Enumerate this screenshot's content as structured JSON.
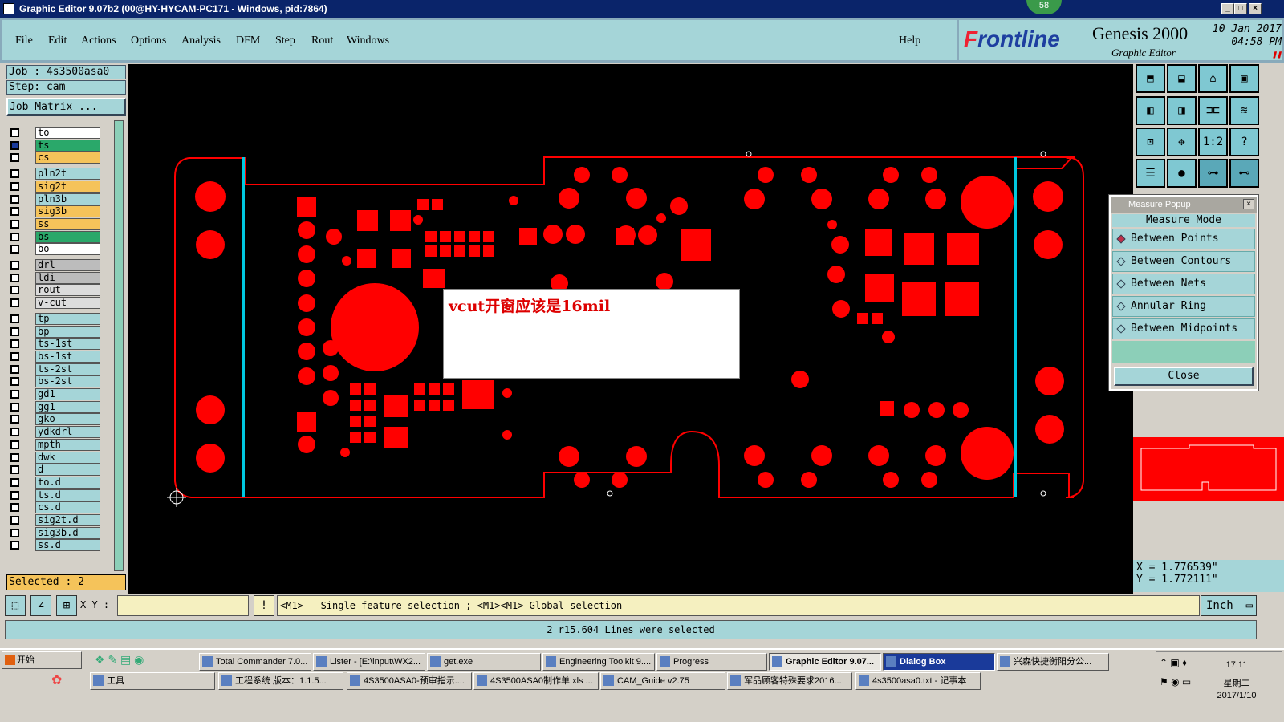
{
  "window": {
    "title": "Graphic Editor 9.07b2 (00@HY-HYCAM-PC171 - Windows, pid:7864)",
    "notification_count": "58"
  },
  "menu": {
    "file": "File",
    "edit": "Edit",
    "actions": "Actions",
    "options": "Options",
    "analysis": "Analysis",
    "dfm": "DFM",
    "step": "Step",
    "rout": "Rout",
    "windows": "Windows",
    "help": "Help"
  },
  "brand": {
    "logo_prefix": "F",
    "logo_rest": "rontline",
    "product": "Genesis 2000",
    "subtitle": "Graphic Editor",
    "date": "10 Jan 2017",
    "time": "04:58 PM"
  },
  "job": {
    "job_label": "Job :  4s3500asa0",
    "step_label": "Step:  cam",
    "matrix_button": "Job Matrix ..."
  },
  "layers": [
    {
      "name": "to",
      "color": "#ffffff"
    },
    {
      "name": "ts",
      "color": "#2aa86a"
    },
    {
      "name": "cs",
      "color": "#f5c35a"
    },
    {
      "name": "pln2t",
      "color": "#a5d5d8"
    },
    {
      "name": "sig2t",
      "color": "#f5c35a"
    },
    {
      "name": "pln3b",
      "color": "#a5d5d8"
    },
    {
      "name": "sig3b",
      "color": "#f5c35a"
    },
    {
      "name": "ss",
      "color": "#f5c35a"
    },
    {
      "name": "bs",
      "color": "#2aa86a"
    },
    {
      "name": "bo",
      "color": "#ffffff"
    },
    {
      "name": "drl",
      "color": "#bcbcbc"
    },
    {
      "name": "ldi",
      "color": "#bcbcbc"
    },
    {
      "name": "rout",
      "color": "#dcdcdc"
    },
    {
      "name": "v-cut",
      "color": "#dcdcdc"
    },
    {
      "name": "tp",
      "color": "#a5d5d8"
    },
    {
      "name": "bp",
      "color": "#a5d5d8"
    },
    {
      "name": "ts-1st",
      "color": "#a5d5d8"
    },
    {
      "name": "bs-1st",
      "color": "#a5d5d8"
    },
    {
      "name": "ts-2st",
      "color": "#a5d5d8"
    },
    {
      "name": "bs-2st",
      "color": "#a5d5d8"
    },
    {
      "name": "gd1",
      "color": "#a5d5d8"
    },
    {
      "name": "gg1",
      "color": "#a5d5d8"
    },
    {
      "name": "gko",
      "color": "#a5d5d8"
    },
    {
      "name": "ydkdrl",
      "color": "#a5d5d8"
    },
    {
      "name": "mpth",
      "color": "#a5d5d8"
    },
    {
      "name": "dwk",
      "color": "#a5d5d8"
    },
    {
      "name": "d",
      "color": "#a5d5d8"
    },
    {
      "name": "to.d",
      "color": "#a5d5d8"
    },
    {
      "name": "ts.d",
      "color": "#a5d5d8"
    },
    {
      "name": "cs.d",
      "color": "#a5d5d8"
    },
    {
      "name": "sig2t.d",
      "color": "#a5d5d8"
    },
    {
      "name": "sig3b.d",
      "color": "#a5d5d8"
    },
    {
      "name": "ss.d",
      "color": "#a5d5d8"
    }
  ],
  "selected_label": "Selected :  2",
  "canvas_note": "vcut开窗应该是16mil",
  "toolbar": {
    "one_to_two": "1:2",
    "help": "?"
  },
  "measure_popup": {
    "title": "Measure Popup",
    "mode_header": "Measure Mode",
    "options": [
      "Between Points",
      "Between Contours",
      "Between Nets",
      "Annular Ring",
      "Between Midpoints"
    ],
    "close": "Close"
  },
  "coords": {
    "x": "X  =  1.776539\"",
    "y": "Y  =  1.772111\""
  },
  "cmd": {
    "xy_label": "X Y :",
    "hint": "<M1> - Single feature selection ; <M1><M1> Global selection",
    "unit": "Inch"
  },
  "status": "2 r15.604 Lines were selected",
  "taskbar": {
    "start": "开始",
    "row1": [
      "Total Commander 7.0...",
      "Lister - [E:\\input\\WX2...",
      "get.exe",
      "Engineering Toolkit 9....",
      "Progress",
      "Graphic Editor 9.07...",
      "Dialog Box",
      "兴森快捷衡阳分公..."
    ],
    "row2": [
      "工具",
      "工程系统  版本：1.1.5...",
      "4S3500ASA0-预审指示....",
      "4S3500ASA0制作单.xls ...",
      "CAM_Guide v2.75",
      "军品顾客特殊要求2016...",
      "4s3500asa0.txt - 记事本"
    ],
    "clock": {
      "time": "17:11",
      "day": "星期二",
      "date": "2017/1/10"
    }
  },
  "colors": {
    "board": "#ff0000",
    "vcut": "#00c8e0",
    "panel": "#a5d5d8"
  }
}
